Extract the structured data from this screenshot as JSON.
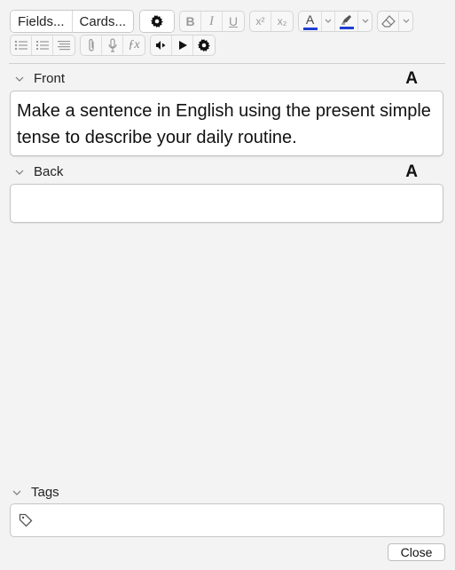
{
  "toolbar": {
    "fields_label": "Fields...",
    "cards_label": "Cards...",
    "bold_glyph": "B",
    "italic_glyph": "I",
    "underline_glyph": "U",
    "superscript_glyph": "x²",
    "subscript_glyph": "x₂",
    "text_color_glyph": "A",
    "text_color": "#1f3fd0",
    "highlight_color": "#1f3fd0",
    "mathjax_glyph": "ƒx"
  },
  "fields": [
    {
      "name": "Front",
      "font_indicator": "A",
      "value": "Make a sentence in English using the present simple tense to describe your daily routine."
    },
    {
      "name": "Back",
      "font_indicator": "A",
      "value": ""
    }
  ],
  "tags": {
    "label": "Tags",
    "value": ""
  },
  "footer": {
    "close_label": "Close"
  },
  "icons": {
    "options": "gear-icon",
    "eraser": "eraser-icon",
    "bulleted_list": "bulleted-list-icon",
    "numbered_list": "numbered-list-icon",
    "align": "align-icon",
    "attach": "paperclip-icon",
    "record": "microphone-icon",
    "mathjax": "function-icon",
    "speaker": "speaker-icon",
    "play": "play-icon",
    "settings": "gear-icon",
    "tag": "tag-icon",
    "collapse": "chevron-down-icon"
  }
}
